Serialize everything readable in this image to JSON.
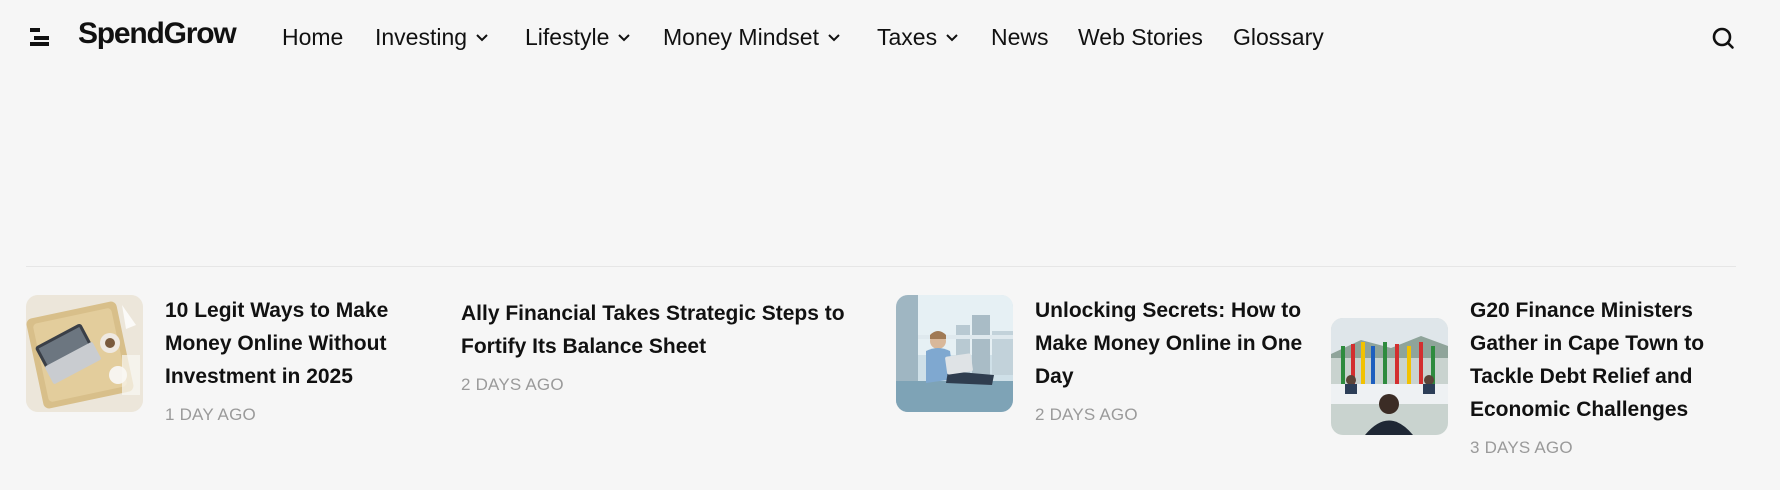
{
  "site": {
    "logo": "SpendGrow"
  },
  "nav": {
    "items": [
      {
        "label": "Home",
        "dropdown": false
      },
      {
        "label": "Investing",
        "dropdown": true
      },
      {
        "label": "Lifestyle",
        "dropdown": true
      },
      {
        "label": "Money Mindset",
        "dropdown": true
      },
      {
        "label": "Taxes",
        "dropdown": true
      },
      {
        "label": "News",
        "dropdown": false
      },
      {
        "label": "Web Stories",
        "dropdown": false
      },
      {
        "label": "Glossary",
        "dropdown": false
      }
    ]
  },
  "icons": {
    "menu": "hamburger-menu-icon",
    "search": "search-icon",
    "chevron": "chevron-down-icon"
  },
  "colors": {
    "background": "#f6f6f6",
    "text": "#111111",
    "meta": "#9a9a9a"
  },
  "posts": [
    {
      "title": "10 Legit Ways to Make Money Online Without Investment in 2025",
      "date": "1 DAY AGO",
      "has_image": true
    },
    {
      "title": "Ally Financial Takes Strategic Steps to Fortify Its Balance Sheet",
      "date": "2 DAYS AGO",
      "has_image": false
    },
    {
      "title": "Unlocking Secrets: How to Make Money Online in One Day",
      "date": "2 DAYS AGO",
      "has_image": true
    },
    {
      "title": "G20 Finance Ministers Gather in Cape Town to Tackle Debt Relief and Economic Challenges",
      "date": "3 DAYS AGO",
      "has_image": true
    }
  ]
}
